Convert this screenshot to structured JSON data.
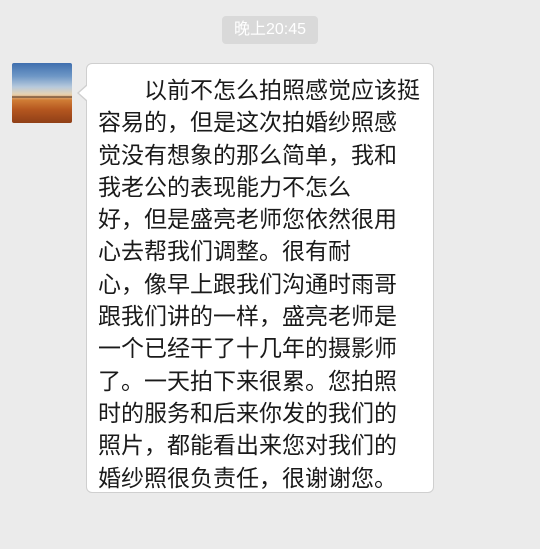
{
  "timestamp": "晚上20:45",
  "message": {
    "lines": [
      "　　以前不怎么拍照感觉应该挺",
      "容易的，但是这次拍婚纱照感",
      "觉没有想象的那么简单，我和",
      "我老公的表现能力不怎么",
      "好，但是盛亮老师您依然很用",
      "心去帮我们调整。很有耐",
      "心，像早上跟我们沟通时雨哥",
      "跟我们讲的一样，盛亮老师是",
      "一个已经干了十几年的摄影师",
      "了。一天拍下来很累。您拍照",
      "时的服务和后来你发的我们的",
      "照片，都能看出来您对我们的",
      "婚纱照很负责任，很谢谢您。"
    ]
  },
  "avatar": {
    "icon": "landscape-avatar-icon"
  },
  "colors": {
    "background": "#ebebeb",
    "bubble": "#ffffff",
    "bubble_border": "#cfcfcf",
    "timestamp_bg": "#d9d9d9",
    "text": "#1a1a1a"
  }
}
